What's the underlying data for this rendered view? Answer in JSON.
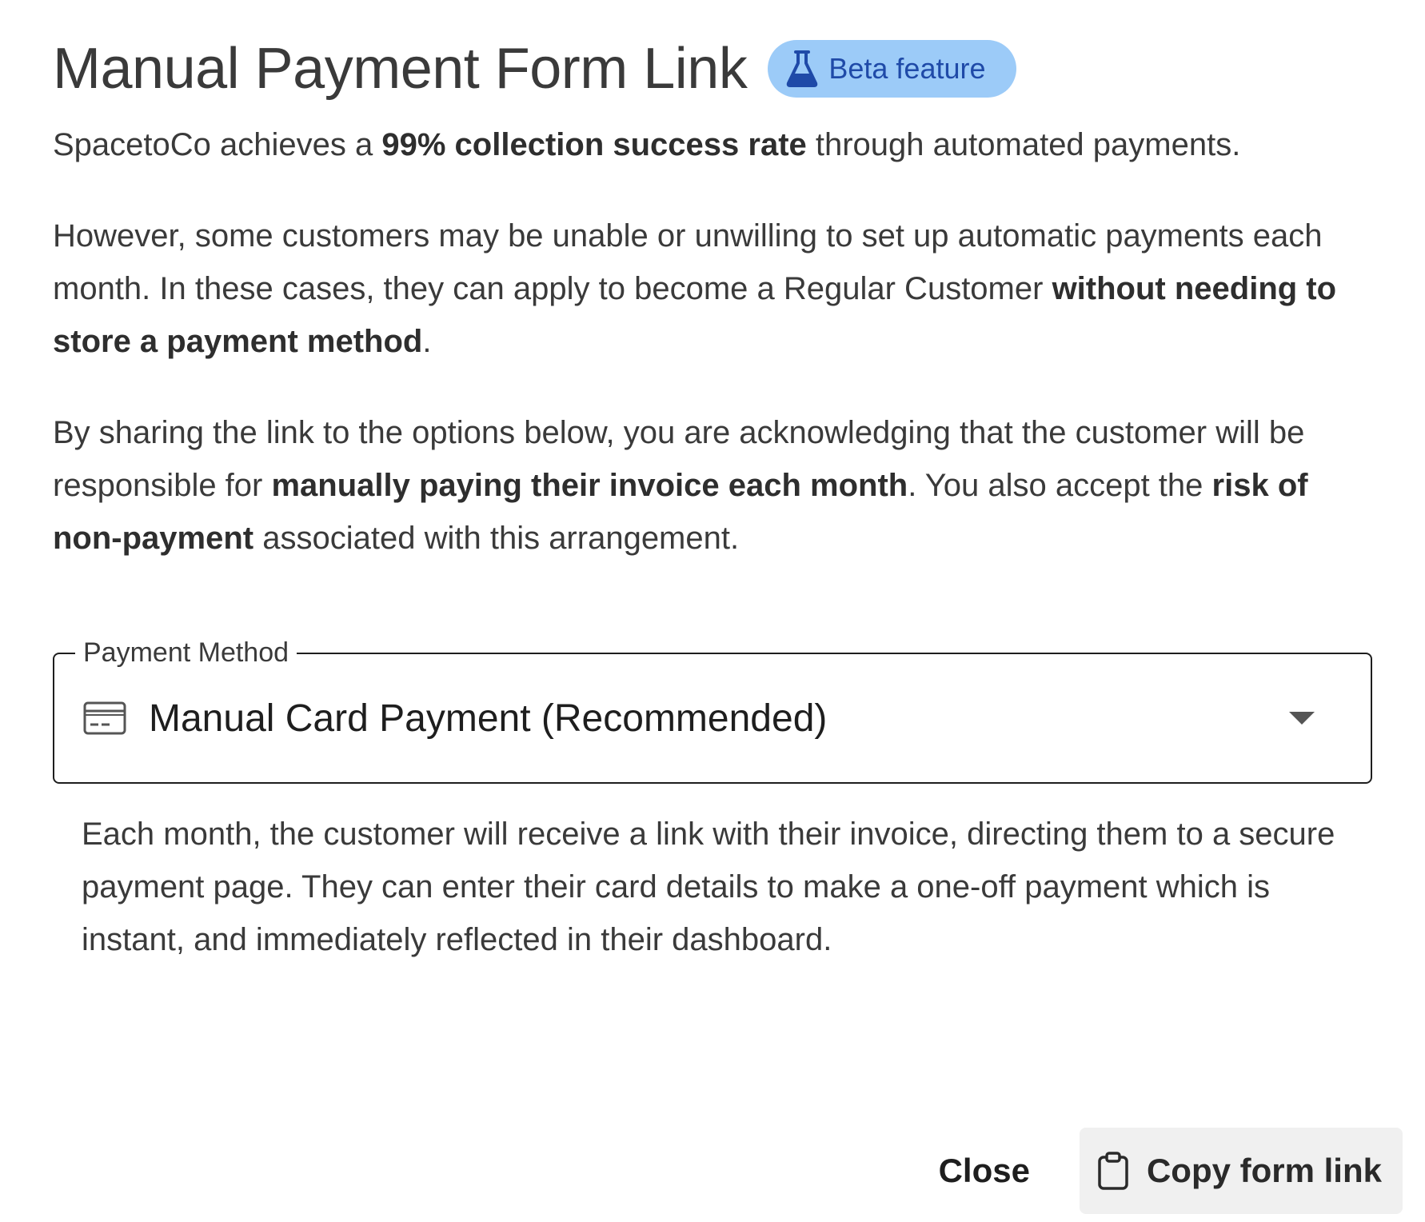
{
  "dialog": {
    "title": "Manual Payment Form Link",
    "badge": {
      "icon": "flask-icon",
      "label": "Beta feature",
      "bg_color": "#9ccbf8",
      "text_color": "#1f4aa8"
    }
  },
  "paragraphs": {
    "p1": {
      "t1": "SpacetoCo achieves a ",
      "b1": "99% collection success rate",
      "t2": " through automated payments."
    },
    "p2": {
      "t1": "However, some customers may be unable or unwilling to set up automatic payments each month. In these cases, they can apply to become a Regular Customer ",
      "b1": "without needing to store a payment method",
      "t2": "."
    },
    "p3": {
      "t1": "By sharing the link to the options below, you are acknowledging that the customer will be responsible for ",
      "b1": "manually paying their invoice each month",
      "t2": ". You also accept the ",
      "b2": "risk of non-payment",
      "t3": " associated with this arrangement."
    }
  },
  "payment_method": {
    "label": "Payment Method",
    "icon": "credit-card-icon",
    "selected": "Manual Card Payment (Recommended)",
    "helper_text": "Each month, the customer will receive a link with their invoice, directing them to a secure payment page. They can enter their card details to make a one-off payment which is instant, and immediately reflected in their dashboard."
  },
  "actions": {
    "close_label": "Close",
    "copy_label": "Copy form link",
    "copy_icon": "clipboard-icon"
  }
}
